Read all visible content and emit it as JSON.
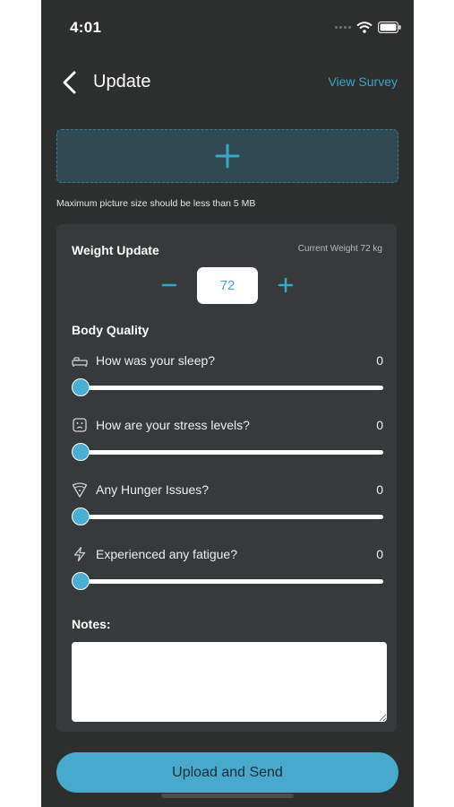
{
  "status_bar": {
    "time": "4:01"
  },
  "header": {
    "title": "Update",
    "view_survey": "View Survey"
  },
  "upload": {
    "max_size_note": "Maximum picture size should be less than 5 MB"
  },
  "weight": {
    "label": "Weight Update",
    "current": "Current Weight 72 kg",
    "value": "72"
  },
  "body_quality": {
    "title": "Body Quality",
    "questions": [
      {
        "label": "How was your sleep?",
        "value": "0",
        "icon": "bed-icon"
      },
      {
        "label": "How are your stress levels?",
        "value": "0",
        "icon": "stress-face-icon"
      },
      {
        "label": "Any Hunger Issues?",
        "value": "0",
        "icon": "pizza-icon"
      },
      {
        "label": "Experienced any fatigue?",
        "value": "0",
        "icon": "lightning-icon"
      }
    ]
  },
  "notes": {
    "label": "Notes:",
    "value": ""
  },
  "actions": {
    "upload_send": "Upload and Send"
  },
  "colors": {
    "accent": "#3aa6c8",
    "background": "#2d2f2f",
    "card": "#373a3b",
    "button": "#47a9cb"
  }
}
